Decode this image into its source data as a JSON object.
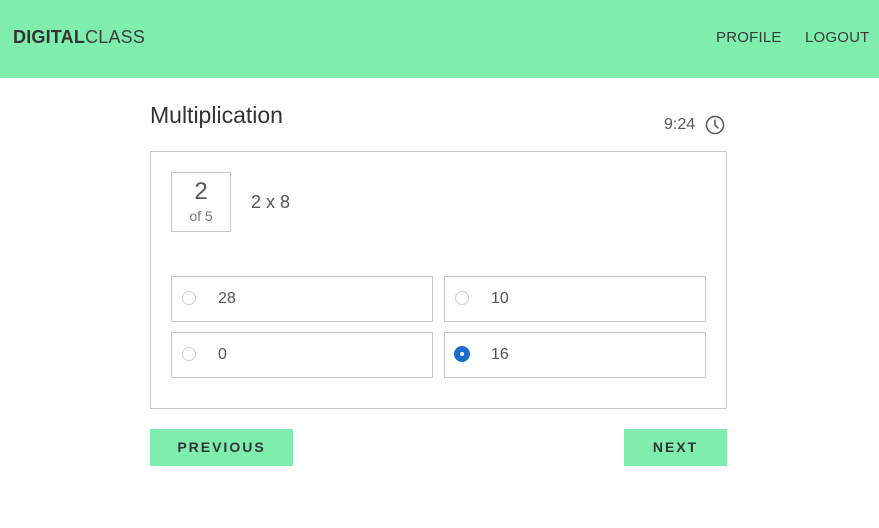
{
  "header": {
    "brand_bold": "DIGITAL",
    "brand_light": "CLASS",
    "nav": {
      "profile": "PROFILE",
      "logout": "LOGOUT"
    },
    "background_color": "#7fedad"
  },
  "quiz": {
    "title": "Multiplication",
    "timer": "9:24",
    "timer_icon": "clock-icon",
    "counter": {
      "current": "2",
      "of_label": "of 5"
    },
    "question": "2 x 8",
    "options": [
      {
        "label": "28",
        "selected": false
      },
      {
        "label": "10",
        "selected": false
      },
      {
        "label": "0",
        "selected": false
      },
      {
        "label": "16",
        "selected": true
      }
    ],
    "selected_color": "#1a6dcc"
  },
  "buttons": {
    "previous": "PREVIOUS",
    "next": "NEXT"
  }
}
